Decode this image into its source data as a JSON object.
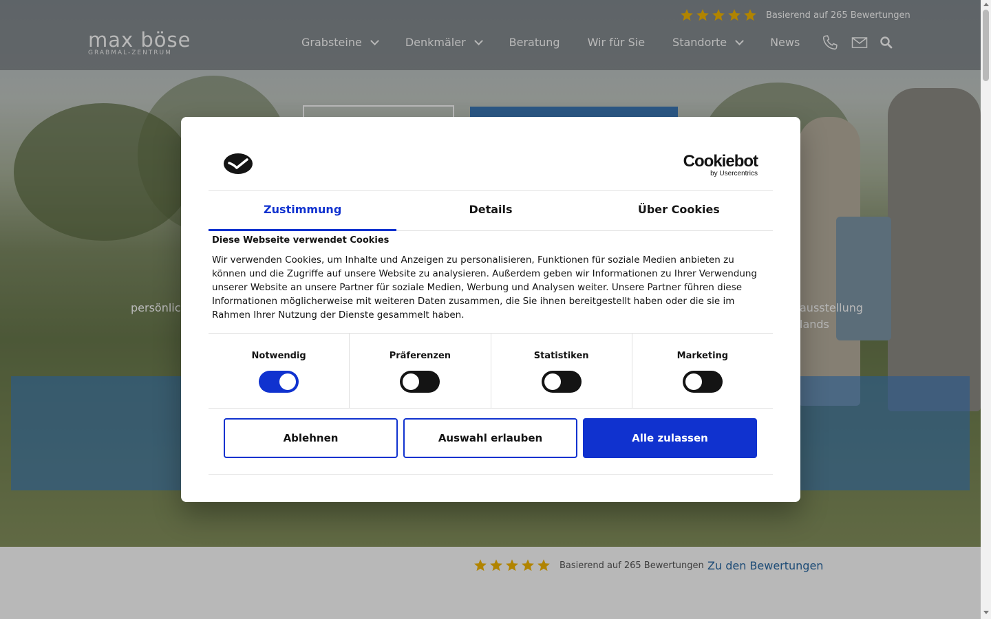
{
  "header": {
    "logo_main": "max böse",
    "logo_sub": "GRABMAL-ZENTRUM",
    "nav": [
      {
        "label": "Grabsteine",
        "dropdown": true
      },
      {
        "label": "Denkmäler",
        "dropdown": true
      },
      {
        "label": "Beratung",
        "dropdown": false
      },
      {
        "label": "Wir für Sie",
        "dropdown": false
      },
      {
        "label": "Standorte",
        "dropdown": true
      },
      {
        "label": "News",
        "dropdown": false
      }
    ],
    "icons": [
      "phone-icon",
      "mail-icon",
      "search-icon"
    ],
    "rating_text": "Basierend auf 265 Bewertungen",
    "rating_stars": 5
  },
  "hero": {
    "text_left": "persönlich",
    "text_right_1": "ausstellung",
    "text_right_2": "lands"
  },
  "below": {
    "rating_text": "Basierend auf 265 Bewertungen",
    "rating_stars": 5,
    "reviews_link": "Zu den Bewertungen"
  },
  "dialog": {
    "brand_main": "Cookiebot",
    "brand_sub": "by Usercentrics",
    "tabs": [
      {
        "label": "Zustimmung",
        "active": true
      },
      {
        "label": "Details",
        "active": false
      },
      {
        "label": "Über Cookies",
        "active": false
      }
    ],
    "title": "Diese Webseite verwendet Cookies",
    "body": "Wir verwenden Cookies, um Inhalte und Anzeigen zu personalisieren, Funktionen für soziale Medien anbieten zu können und die Zugriffe auf unsere Website zu analysieren. Außerdem geben wir Informationen zu Ihrer Verwendung unserer Website an unsere Partner für soziale Medien, Werbung und Analysen weiter. Unsere Partner führen diese Informationen möglicherweise mit weiteren Daten zusammen, die Sie ihnen bereitgestellt haben oder die sie im Rahmen Ihrer Nutzung der Dienste gesammelt haben.",
    "toggles": [
      {
        "label": "Notwendig",
        "checked": true
      },
      {
        "label": "Präferenzen",
        "checked": false
      },
      {
        "label": "Statistiken",
        "checked": false
      },
      {
        "label": "Marketing",
        "checked": false
      }
    ],
    "buttons": {
      "decline": "Ablehnen",
      "allow_selection": "Auswahl erlauben",
      "allow_all": "Alle zulassen"
    }
  },
  "colors": {
    "accent": "#1032cf",
    "star": "#f5b800",
    "link": "#2a6aa5",
    "hero_blue": "#3c79b8"
  }
}
